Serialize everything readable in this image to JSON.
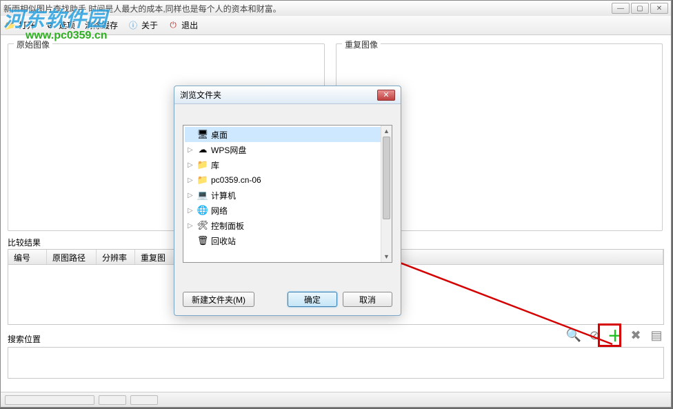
{
  "window": {
    "title": "新雨相似图片查找助手   时间是人最大的成本,同样也是每个人的资本和财富。"
  },
  "toolbar": {
    "open": "打开",
    "options": "选项",
    "clear_cache": "清除缓存",
    "about": "关于",
    "exit": "退出"
  },
  "watermark": {
    "text": "河东软件园",
    "url": "www.pc0359.cn"
  },
  "groups": {
    "original": "原始图像",
    "duplicate": "重复图像"
  },
  "compare": {
    "label": "比较结果"
  },
  "columns": {
    "id": "编号",
    "src_path": "原图路径",
    "resolution": "分辨率",
    "dup_path": "重复图"
  },
  "search": {
    "label": "搜索位置"
  },
  "dialog": {
    "title": "浏览文件夹",
    "tree": [
      {
        "label": "桌面",
        "icon": "🖥",
        "selected": true,
        "expandable": false
      },
      {
        "label": "WPS网盘",
        "icon": "☁",
        "expandable": true
      },
      {
        "label": "库",
        "icon": "📁",
        "expandable": true
      },
      {
        "label": "pc0359.cn-06",
        "icon": "📁",
        "expandable": true
      },
      {
        "label": "计算机",
        "icon": "💻",
        "expandable": true
      },
      {
        "label": "网络",
        "icon": "🌐",
        "expandable": true
      },
      {
        "label": "控制面板",
        "icon": "🛠",
        "expandable": true
      },
      {
        "label": "回收站",
        "icon": "🗑",
        "expandable": false
      }
    ],
    "new_folder": "新建文件夹(M)",
    "ok": "确定",
    "cancel": "取消"
  }
}
